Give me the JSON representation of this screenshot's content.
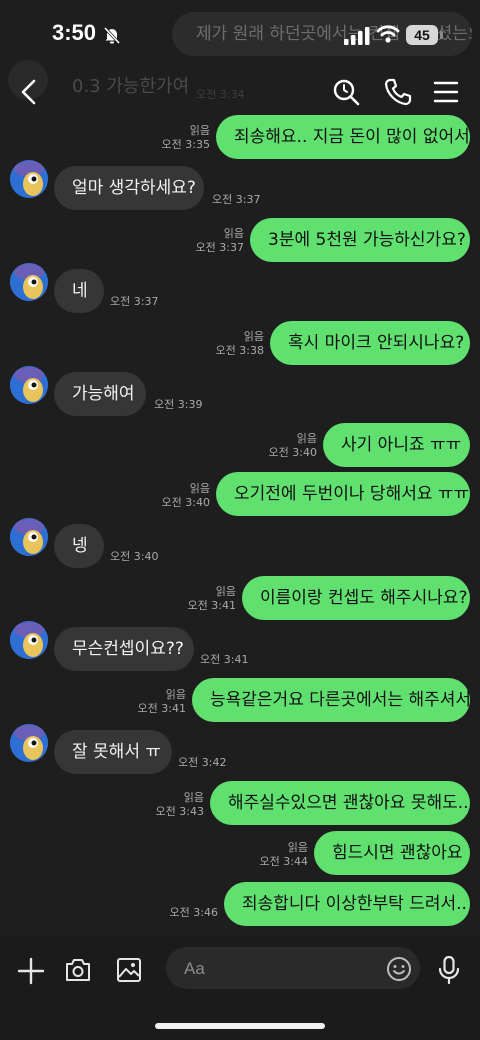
{
  "status_bar": {
    "time": "3:50",
    "battery": "45",
    "ghost_bubble_text": "제가 원래 하던곳에서는 컨셉 해주셨는요"
  },
  "header": {
    "ghost_title": "0.3 가능한가여",
    "ghost_time": "오전 3:34"
  },
  "messages": [
    {
      "side": "out",
      "text": "죄송해요.. 지금 돈이 많이 없어서",
      "read": "읽음",
      "time": "오전 3:35"
    },
    {
      "side": "in",
      "text": "얼마 생각하세요?",
      "time": "오전 3:37"
    },
    {
      "side": "out",
      "text": "3분에 5천원 가능하신가요?",
      "read": "읽음",
      "time": "오전 3:37"
    },
    {
      "side": "in",
      "text": "네",
      "time": "오전 3:37"
    },
    {
      "side": "out",
      "text": "혹시 마이크 안되시나요?",
      "read": "읽음",
      "time": "오전 3:38"
    },
    {
      "side": "in",
      "text": "가능해여",
      "time": "오전 3:39"
    },
    {
      "side": "out",
      "text": "사기 아니죠 ㅠㅠ",
      "read": "읽음",
      "time": "오전 3:40"
    },
    {
      "side": "out",
      "text": "오기전에 두번이나 당해서요 ㅠㅠ",
      "read": "읽음",
      "time": "오전 3:40"
    },
    {
      "side": "in",
      "text": "넹",
      "time": "오전 3:40"
    },
    {
      "side": "out",
      "text": "이름이랑 컨셉도 해주시나요?",
      "read": "읽음",
      "time": "오전 3:41"
    },
    {
      "side": "in",
      "text": "무슨컨셉이요??",
      "time": "오전 3:41"
    },
    {
      "side": "out",
      "text": "능욕같은거요 다른곳에서는 해주셔서",
      "read": "읽음",
      "time": "오전 3:41"
    },
    {
      "side": "in",
      "text": "잘 못해서 ㅠ",
      "time": "오전 3:42"
    },
    {
      "side": "out",
      "text": "해주실수있으면 괜찮아요 못해도..",
      "read": "읽음",
      "time": "오전 3:43"
    },
    {
      "side": "out",
      "text": "힘드시면 괜찮아요",
      "read": "읽음",
      "time": "오전 3:44"
    },
    {
      "side": "out",
      "text": "죄송합니다 이상한부탁 드려서..",
      "time": "오전 3:46"
    }
  ],
  "input": {
    "placeholder": "Aa"
  },
  "colors": {
    "outgoing_bubble": "#5fe06f",
    "incoming_bubble": "#363636",
    "background": "#1e1e1e"
  },
  "icons": [
    "back-icon",
    "search-icon",
    "phone-icon",
    "menu-icon",
    "plus-icon",
    "camera-icon",
    "gallery-icon",
    "emoji-icon",
    "mic-icon"
  ]
}
